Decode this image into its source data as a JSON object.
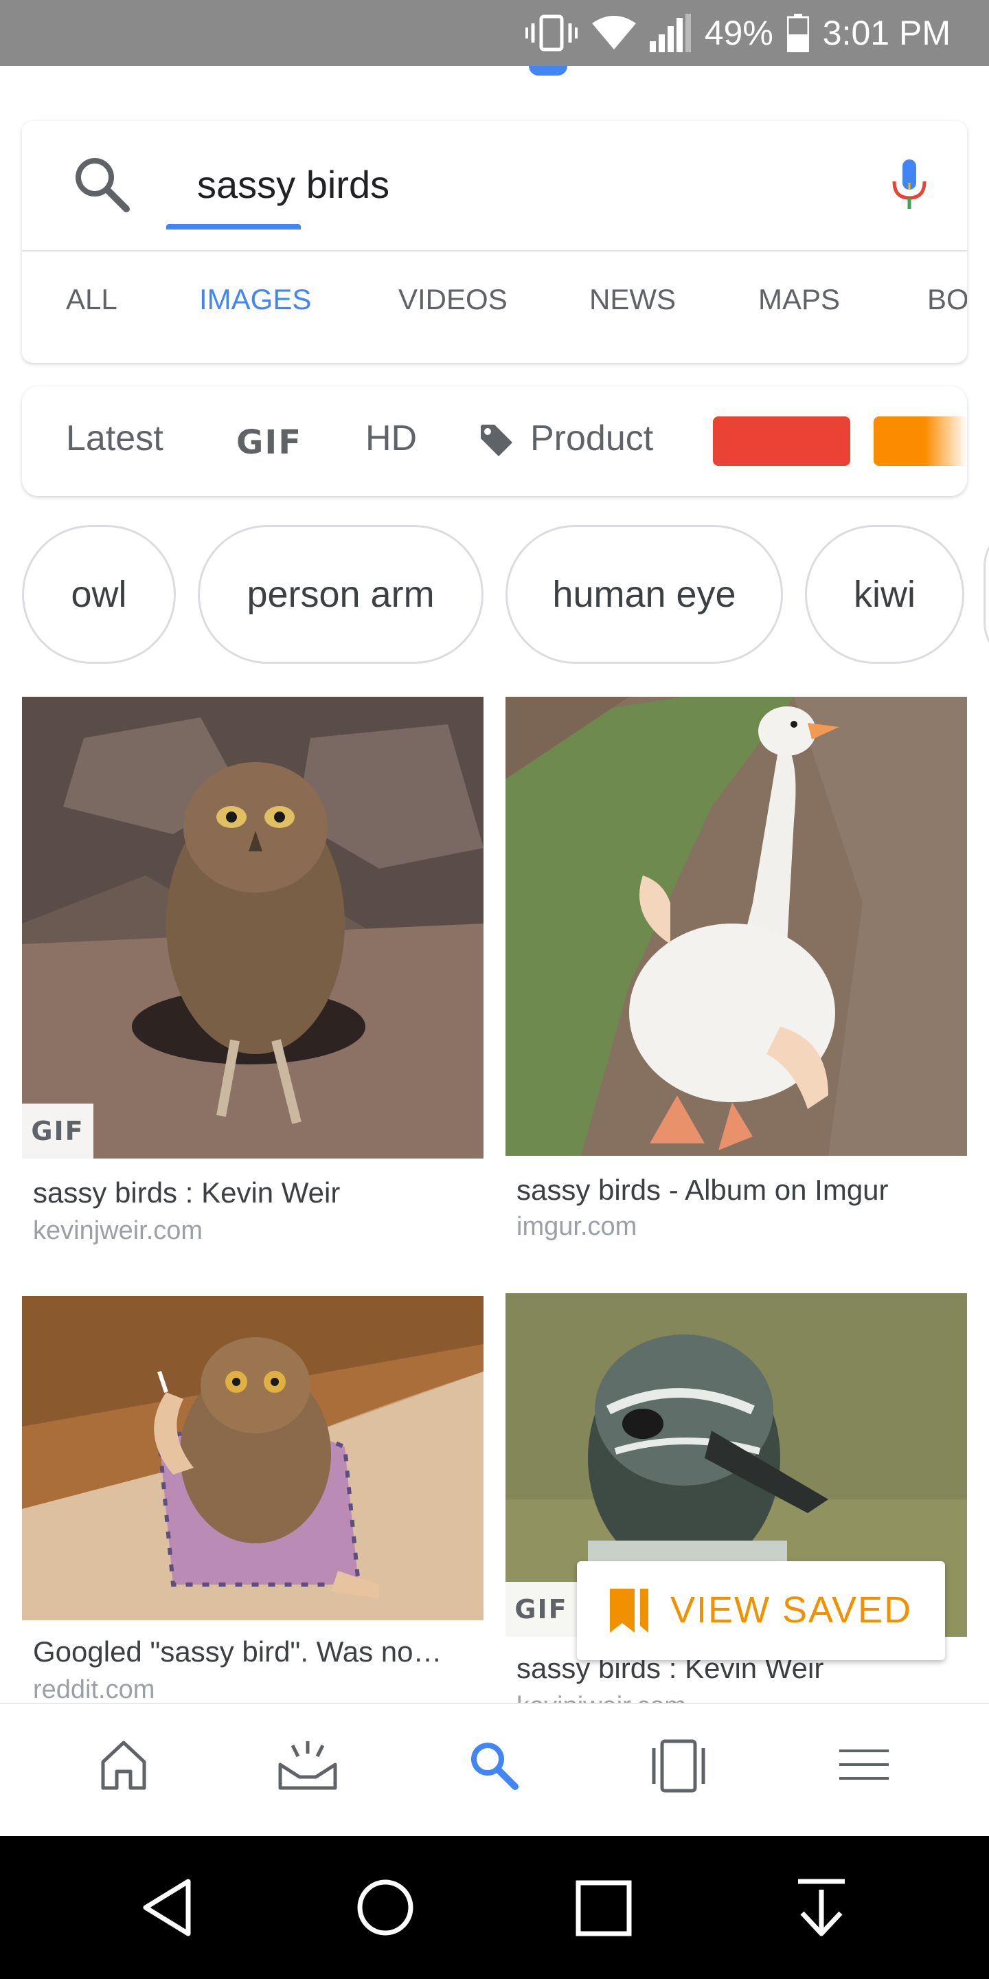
{
  "status_bar": {
    "battery": "49%",
    "time": "3:01 PM",
    "icons": [
      "vibrate-icon",
      "wifi-icon",
      "signal-icon",
      "battery-icon"
    ]
  },
  "search": {
    "query": "sassy birds",
    "icons": [
      "search-icon",
      "mic-icon"
    ]
  },
  "tabs": {
    "items": [
      "ALL",
      "IMAGES",
      "VIDEOS",
      "NEWS",
      "MAPS",
      "BO"
    ],
    "active": "IMAGES"
  },
  "filters": {
    "latest": "Latest",
    "gif": "GIF",
    "hd": "HD",
    "product": "Product",
    "colors": [
      "#ea4335",
      "#fb8c00"
    ]
  },
  "chips": [
    "owl",
    "person arm",
    "human eye",
    "kiwi"
  ],
  "results": [
    {
      "title": "sassy birds : Kevin Weir",
      "domain": "kevinjweir.com",
      "badge": "GIF"
    },
    {
      "title": "sassy birds - Album on Imgur",
      "domain": "imgur.com"
    },
    {
      "title": "Googled \"sassy bird\". Was no…",
      "domain": "reddit.com"
    },
    {
      "title": "sassy birds : Kevin Weir",
      "domain": "kevinjweir.com",
      "badge": "GIF"
    }
  ],
  "view_saved": {
    "label": "VIEW SAVED"
  },
  "bottom_nav": {
    "items": [
      "home-icon",
      "updates-icon",
      "search-icon",
      "tabs-icon",
      "menu-icon"
    ],
    "active": "search-icon",
    "accent": "#4285f4"
  },
  "system_nav": [
    "back-icon",
    "home-icon",
    "recents-icon",
    "download-icon"
  ]
}
